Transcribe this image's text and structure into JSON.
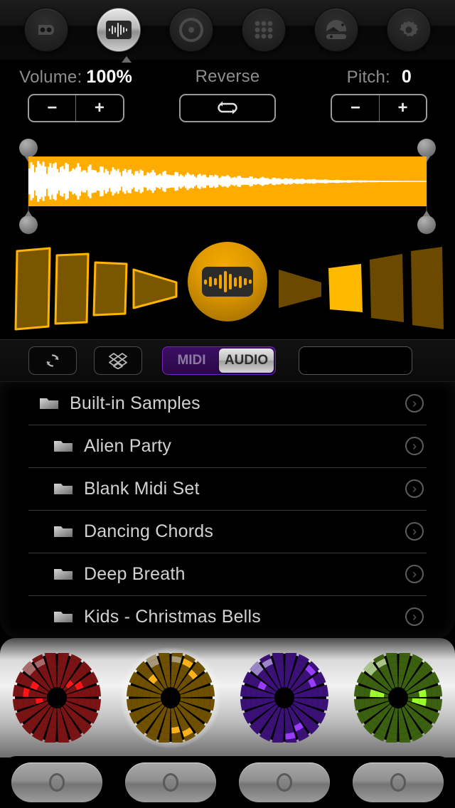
{
  "topnav": {
    "items": [
      {
        "icon": "tape-loop-icon",
        "name": "nav-loops",
        "active": false
      },
      {
        "icon": "waveform-icon",
        "name": "nav-sampler",
        "active": true
      },
      {
        "icon": "record-disc-icon",
        "name": "nav-record",
        "active": false
      },
      {
        "icon": "pad-grid-icon",
        "name": "nav-pads",
        "active": false
      },
      {
        "icon": "mixer-icon",
        "name": "nav-mixer",
        "active": false
      },
      {
        "icon": "gear-icon",
        "name": "nav-settings",
        "active": false
      }
    ]
  },
  "params": {
    "volume": {
      "caption": "Volume:",
      "value": "100%",
      "minus": "−",
      "plus": "+"
    },
    "reverse": {
      "caption": "Reverse",
      "icon": "loop-icon"
    },
    "pitch": {
      "caption": "Pitch:",
      "value": "0",
      "minus": "−",
      "plus": "+"
    }
  },
  "waveform": {
    "color": "#FFAC00",
    "wave_color": "#FFFFFF",
    "handles": [
      "start-top",
      "start-bottom",
      "end-top",
      "end-bottom"
    ]
  },
  "cones": {
    "selected_index": 5,
    "center_button": "sample-waveform-button",
    "outline_color": "#FFB400",
    "fill_color": "#7A5600",
    "highlight_color": "#FFBA00"
  },
  "toolbar": {
    "refresh": {
      "label": "",
      "icon": "refresh-icon"
    },
    "dropbox": {
      "label": "",
      "icon": "dropbox-icon"
    },
    "segmented": {
      "options": [
        "MIDI",
        "AUDIO"
      ],
      "selected": "AUDIO"
    },
    "search": {
      "value": "",
      "placeholder": "",
      "icon": "search-icon"
    },
    "accent_purple": "#7b21c4"
  },
  "filelist": {
    "rows": [
      {
        "label": "Built-in Samples",
        "indent": 0,
        "icon": "folder-icon",
        "chevron": "›"
      },
      {
        "label": "Alien Party",
        "indent": 1,
        "icon": "folder-icon",
        "chevron": "›"
      },
      {
        "label": "Blank Midi Set",
        "indent": 1,
        "icon": "folder-icon",
        "chevron": "›"
      },
      {
        "label": "Dancing Chords",
        "indent": 1,
        "icon": "folder-icon",
        "chevron": "›"
      },
      {
        "label": "Deep Breath",
        "indent": 1,
        "icon": "folder-icon",
        "chevron": "›"
      },
      {
        "label": "Kids - Christmas Bells",
        "indent": 1,
        "icon": "folder-icon",
        "chevron": "›"
      }
    ]
  },
  "pads": {
    "items": [
      {
        "name": "pad-red",
        "base": "#7a1414",
        "lit": "#FF1515",
        "dim": "#a86a6a",
        "selected": false
      },
      {
        "name": "pad-amber",
        "base": "#6e5000",
        "lit": "#FFB11A",
        "dim": "#a89a78",
        "selected": true
      },
      {
        "name": "pad-purple",
        "base": "#3b1178",
        "lit": "#9A3CFF",
        "dim": "#9a86c4",
        "selected": false
      },
      {
        "name": "pad-green",
        "base": "#3a6010",
        "lit": "#9BFF2E",
        "dim": "#a8c488",
        "selected": false
      }
    ]
  },
  "bottombar": {
    "buttons": [
      {
        "name": "transport-button-1",
        "icon": "circle-knob-icon"
      },
      {
        "name": "transport-button-2",
        "icon": "circle-knob-icon"
      },
      {
        "name": "transport-button-3",
        "icon": "circle-knob-icon"
      },
      {
        "name": "transport-button-4",
        "icon": "circle-knob-icon"
      }
    ]
  }
}
